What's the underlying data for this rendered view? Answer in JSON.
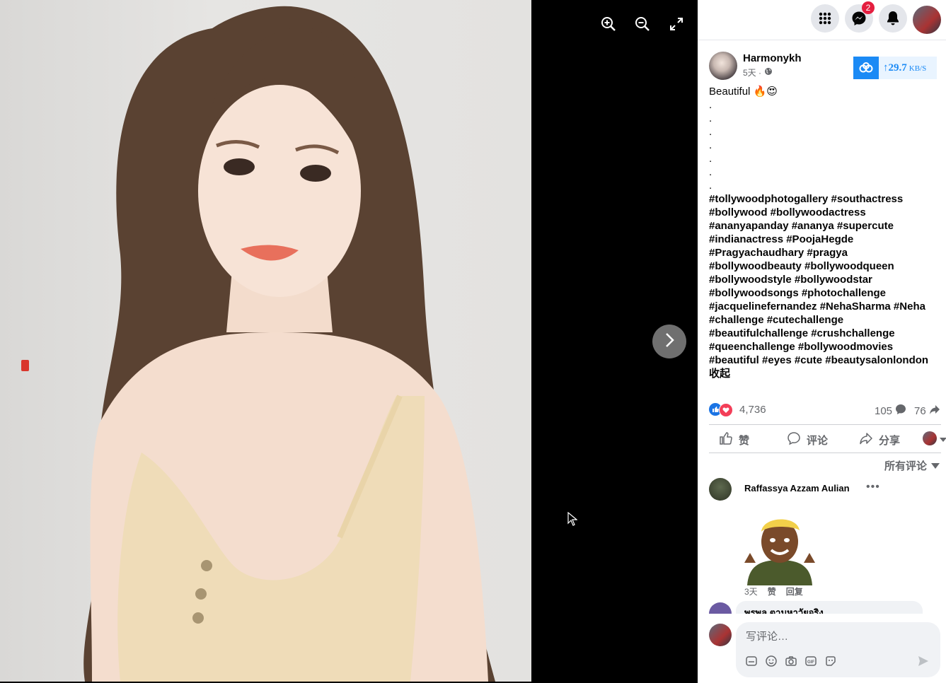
{
  "viewer": {
    "zoom_in_icon": "zoom-in-icon",
    "zoom_out_icon": "zoom-out-icon",
    "fullscreen_icon": "fullscreen-icon",
    "next_icon": "chevron-right-icon"
  },
  "topbar": {
    "menu_icon": "grid-menu-icon",
    "messenger_icon": "messenger-icon",
    "messenger_badge": "2",
    "notifications_icon": "bell-icon"
  },
  "post": {
    "author": "Harmonykh",
    "time": "5天 ·",
    "speed_value": "29.7",
    "speed_unit": "KB/S",
    "caption": "Beautiful 🔥😍",
    "dots": [
      ".",
      ".",
      ".",
      ".",
      ".",
      ".",
      "."
    ],
    "hashtags": [
      "#tollywoodphotogallery #southactress",
      "#bollywood #bollywoodactress",
      "#ananyapanday #ananya #supercute",
      "#indianactress #PoojaHegde",
      "#Pragyachaudhary #pragya",
      "#bollywoodbeauty #bollywoodqueen",
      "#bollywoodstyle #bollywoodstar",
      "#bollywoodsongs #photochallenge",
      "#jacquelinefernandez #NehaSharma #Neha",
      "#challenge #cutechallenge",
      "#beautifulchallenge #crushchallenge",
      "#queenchallenge #bollywoodmovies",
      "#beautiful #eyes #cute #beautysalonlondon"
    ],
    "collapse": "收起",
    "reaction_count": "4,736",
    "comment_count": "105",
    "share_count": "76"
  },
  "actions": {
    "like": "赞",
    "comment": "评论",
    "share": "分享"
  },
  "comments": {
    "filter": "所有评论",
    "items": [
      {
        "name": "Raffassya Azzam Aulian",
        "time": "3天",
        "like": "赞",
        "reply": "回复"
      },
      {
        "name": "พรพล ตามหาวัยจริง"
      }
    ]
  },
  "composer": {
    "placeholder": "写评论…"
  },
  "colors": {
    "accent": "#1b74e4",
    "badge": "#e41e3f",
    "speed": "#1b8af5"
  }
}
